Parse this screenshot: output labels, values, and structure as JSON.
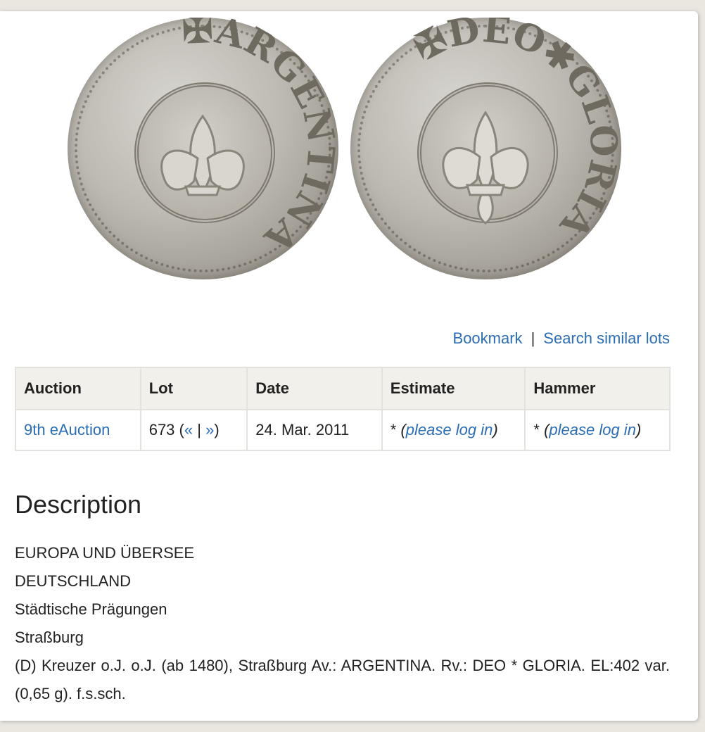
{
  "images": {
    "obverse": {
      "legend": "✠ARGENTINA"
    },
    "reverse": {
      "legend": "✠DEO✱GLORIA"
    }
  },
  "actions": {
    "bookmark": "Bookmark",
    "separator": "|",
    "search_similar": "Search similar lots"
  },
  "table": {
    "headers": [
      "Auction",
      "Lot",
      "Date",
      "Estimate",
      "Hammer"
    ],
    "row": {
      "auction": "9th eAuction",
      "lot_number": "673",
      "lot_open": "(",
      "lot_prev": "«",
      "lot_sep": "|",
      "lot_next": "»",
      "lot_close": ")",
      "date": "24. Mar. 2011",
      "estimate_star": "*",
      "estimate_link": "please log in",
      "hammer_star": "*",
      "hammer_link": "please log in"
    }
  },
  "description": {
    "title": "Description",
    "lines": [
      "EUROPA UND ÜBERSEE",
      "DEUTSCHLAND",
      "Städtische Prägungen",
      "Straßburg"
    ],
    "detail": "(D) Kreuzer o.J. o.J. (ab 1480), Straßburg Av.: ARGENTINA. Rv.: DEO * GLORIA. EL:402 var. (0,65 g). f.s.sch."
  }
}
